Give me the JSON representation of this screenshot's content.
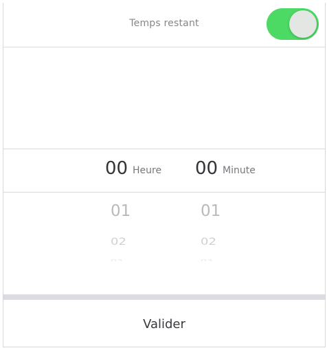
{
  "header": {
    "title": "Temps restant",
    "toggle_on": true
  },
  "colors": {
    "toggle_on": "#4cd964",
    "separator": "#dcdbe2",
    "text_primary": "#333338",
    "text_secondary": "#85858c"
  },
  "picker": {
    "hours": {
      "selected": "00",
      "unit": "Heure",
      "options": [
        "01",
        "02",
        "03"
      ]
    },
    "minutes": {
      "selected": "00",
      "unit": "Minute",
      "options": [
        "01",
        "02",
        "03"
      ]
    }
  },
  "footer": {
    "validate_label": "Valider"
  }
}
